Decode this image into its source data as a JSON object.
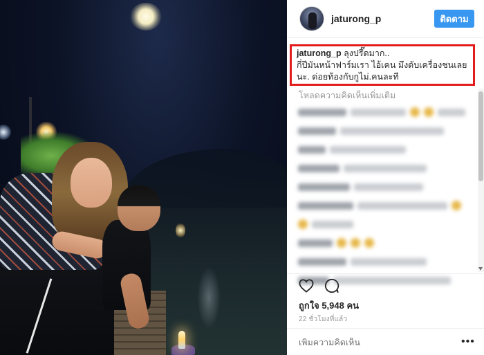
{
  "post": {
    "username": "jaturong_p",
    "follow_label": "ติดตาม",
    "caption": {
      "username": "jaturong_p",
      "line1": "ลุงปรึ๊ดมาก..",
      "line2": "กี่ปีมันหน้าฟาร์มเรา ไอ้เคน มึงดับเครื่องชนเลย",
      "line3": "นะ. ด่อยท้องกับกูไม่.คนละที"
    },
    "load_more_label": "โหลดความคิดเห็นเพิ่มเติม",
    "likes_label": "ถูกใจ 5,948 คน",
    "time_label": "22 ชั่วโมงที่แล้ว",
    "add_comment_placeholder": "เพิ่มความคิดเห็น",
    "more_label": "•••"
  },
  "icons": {
    "like": "heart-icon",
    "comment": "comment-icon",
    "more": "more-icon"
  },
  "colors": {
    "follow_button": "#3897f0",
    "highlight_box": "#e31b1b",
    "muted_text": "#999999"
  }
}
